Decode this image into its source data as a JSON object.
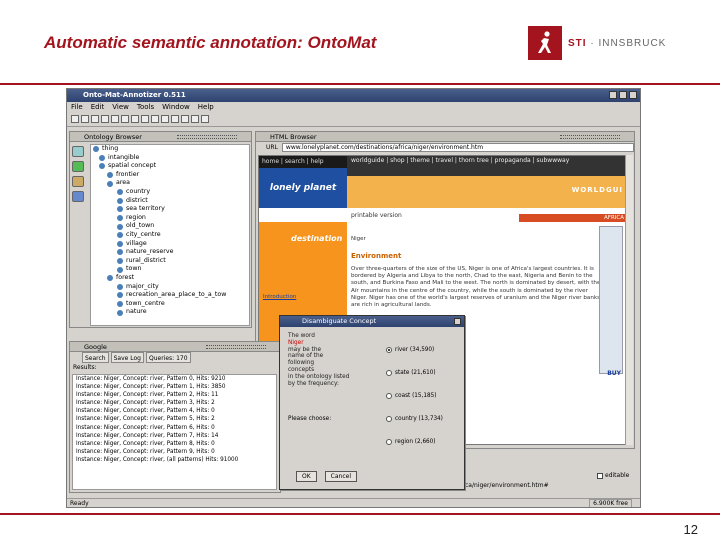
{
  "slide": {
    "title": "Automatic semantic annotation: OntoMat",
    "logo_text_a": "STI",
    "logo_text_b": " · INNSBRUCK",
    "page_number": "12",
    "brand_color": "#a3141e"
  },
  "app": {
    "window_title": "Onto-Mat-Annotizer 0.511",
    "menu": [
      "File",
      "Edit",
      "View",
      "Tools",
      "Window",
      "Help"
    ],
    "status": "Ready",
    "memory": "6.900K free"
  },
  "ontology": {
    "title": "Ontology Browser",
    "tree": [
      "thing",
      "intangible",
      "spatial concept",
      "frontier",
      "area",
      "country",
      "district",
      "sea territory",
      "region",
      "old_town",
      "city_centre",
      "village",
      "nature_reserve",
      "rural_district",
      "town",
      "forest",
      "major_city",
      "recreation_area_place_to_a_tow",
      "town_centre",
      "nature"
    ]
  },
  "browser": {
    "title": "HTML Browser",
    "url_label": "URL",
    "url": "www.lonelyplanet.com/destinations/africa/niger/environment.htm",
    "nav_left": "home | search | help",
    "nav_right": "worldguide | shop | theme | travel | thorn tree | propaganda | subwwway",
    "brand": "lonely planet",
    "banner": "WORLDGUI",
    "print_version": "printable version",
    "africa_tab": "AFRICA",
    "destination": "destination",
    "intro_link": "Introduction",
    "region_label": "Niger",
    "section": "Environment",
    "body": "Over three-quarters of the size of the US, Niger is one of Africa's largest countries. It is bordered by Algeria and Libya to the north, Chad to the east, Nigeria and Benin to the south, and Burkina Faso and Mali to the west. The north is dominated by desert, with the Aïr mountains in the centre of the country, while the south is dominated by the river Niger. Niger has one of the world's largest reserves of uranium and the Niger river banks are rich in agricultural lands.",
    "buy": "BUY",
    "status_url": "ca/niger/environment.htm#",
    "editable_label": "editable"
  },
  "google": {
    "title": "Google",
    "tabs": [
      "Search",
      "Save Log",
      "Queries: 170"
    ],
    "results_label": "Results:",
    "results": [
      "Instance: Niger, Concept: river, Pattern 0, Hits: 9210",
      "Instance: Niger, Concept: river, Pattern 1, Hits: 3850",
      "Instance: Niger, Concept: river, Pattern 2, Hits: 11",
      "Instance: Niger, Concept: river, Pattern 3, Hits: 2",
      "Instance: Niger, Concept: river, Pattern 4, Hits: 0",
      "Instance: Niger, Concept: river, Pattern 5, Hits: 2",
      "Instance: Niger, Concept: river, Pattern 6, Hits: 0",
      "Instance: Niger, Concept: river, Pattern 7, Hits: 14",
      "Instance: Niger, Concept: river, Pattern 8, Hits: 0",
      "Instance: Niger, Concept: river, Pattern 9, Hits: 0",
      "Instance: Niger, Concept: river, (all patterns) Hits: 91000"
    ]
  },
  "dialog": {
    "title": "Disambiguate Concept",
    "lines": [
      "The word",
      "Niger",
      "may be the",
      "name of the",
      "following",
      "concepts",
      "in the ontology listed",
      "by the frequency:"
    ],
    "prompt": "Please choose:",
    "options": [
      "river (34,590)",
      "state (21,610)",
      "coast (15,185)",
      "country (13,734)",
      "region (2,660)"
    ],
    "ok": "OK",
    "cancel": "Cancel"
  }
}
